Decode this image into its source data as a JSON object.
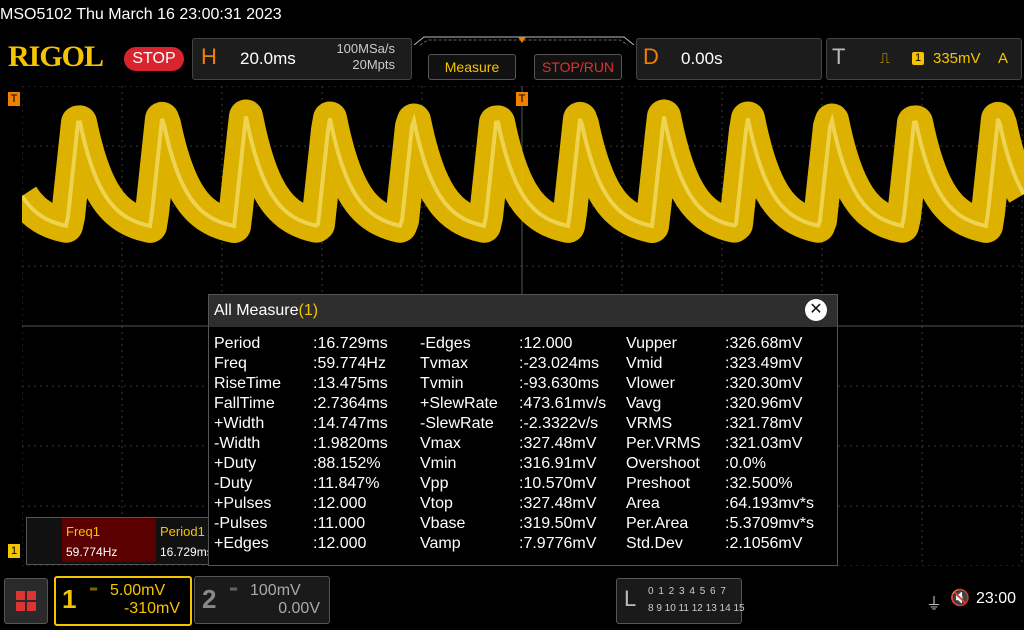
{
  "header": {
    "model_datetime": "MSO5102  Thu March 16 23:00:31 2023",
    "logo": "RIGOL",
    "run_state": "STOP"
  },
  "horizontal": {
    "letter": "H",
    "timebase": "20.0ms",
    "sample_rate": "100MSa/s",
    "memory_depth": "20Mpts"
  },
  "buttons": {
    "measure": "Measure",
    "stop_run": "STOP/RUN"
  },
  "delay": {
    "letter": "D",
    "value": "0.00s"
  },
  "trigger": {
    "letter": "T",
    "source": "1",
    "level": "335mV",
    "mode": "A"
  },
  "measure_panel": {
    "title": "All Measure",
    "count": "(1)",
    "col1": [
      {
        "name": "Period",
        "value": ":16.729ms"
      },
      {
        "name": "Freq",
        "value": ":59.774Hz"
      },
      {
        "name": "RiseTime",
        "value": ":13.475ms"
      },
      {
        "name": "FallTime",
        "value": ":2.7364ms"
      },
      {
        "name": "+Width",
        "value": ":14.747ms"
      },
      {
        "name": "-Width",
        "value": ":1.9820ms"
      },
      {
        "name": "+Duty",
        "value": ":88.152%"
      },
      {
        "name": "-Duty",
        "value": ":11.847%"
      },
      {
        "name": "+Pulses",
        "value": ":12.000"
      },
      {
        "name": "-Pulses",
        "value": ":11.000"
      },
      {
        "name": "+Edges",
        "value": ":12.000"
      }
    ],
    "col2": [
      {
        "name": "-Edges",
        "value": ":12.000"
      },
      {
        "name": "Tvmax",
        "value": ":-23.024ms"
      },
      {
        "name": "Tvmin",
        "value": ":-93.630ms"
      },
      {
        "name": "+SlewRate",
        "value": ":473.61mv/s"
      },
      {
        "name": "-SlewRate",
        "value": ":-2.3322v/s"
      },
      {
        "name": "Vmax",
        "value": ":327.48mV"
      },
      {
        "name": "Vmin",
        "value": ":316.91mV"
      },
      {
        "name": "Vpp",
        "value": ":10.570mV"
      },
      {
        "name": "Vtop",
        "value": ":327.48mV"
      },
      {
        "name": "Vbase",
        "value": ":319.50mV"
      },
      {
        "name": "Vamp",
        "value": ":7.9776mV"
      }
    ],
    "col3": [
      {
        "name": "Vupper",
        "value": ":326.68mV"
      },
      {
        "name": "Vmid",
        "value": ":323.49mV"
      },
      {
        "name": "Vlower",
        "value": ":320.30mV"
      },
      {
        "name": "Vavg",
        "value": ":320.96mV"
      },
      {
        "name": "VRMS",
        "value": ":321.78mV"
      },
      {
        "name": "Per.VRMS",
        "value": ":321.03mV"
      },
      {
        "name": "Overshoot",
        "value": ":0.0%"
      },
      {
        "name": "Preshoot",
        "value": ":32.500%"
      },
      {
        "name": "Area",
        "value": ":64.193mv*s"
      },
      {
        "name": "Per.Area",
        "value": ":5.3709mv*s"
      },
      {
        "name": "Std.Dev",
        "value": ":2.1056mV"
      }
    ]
  },
  "mini_measure": {
    "label1": "Freq1",
    "value1": "59.774Hz",
    "label2": "Period1",
    "value2": "16.729ms"
  },
  "ch1": {
    "num": "1",
    "scale": "5.00mV",
    "offset": "-310mV",
    "color": "#f5c400"
  },
  "ch2": {
    "num": "2",
    "scale": "100mV",
    "offset": "0.00V"
  },
  "logic": {
    "letter": "L",
    "row1": "0 1 2 3  4 5 6 7",
    "row2": "8 9 10 11 12 13 14 15"
  },
  "status": {
    "time": "23:00"
  }
}
